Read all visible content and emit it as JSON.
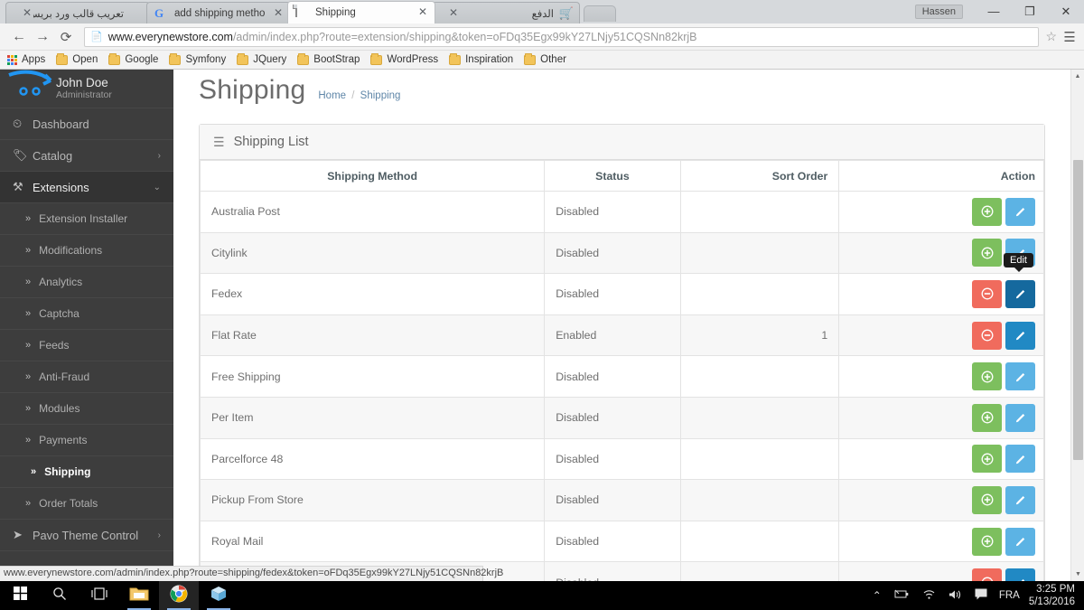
{
  "browser": {
    "profile_chip": "Hassen",
    "window_buttons": {
      "minimize": "—",
      "maximize": "❐",
      "close": "✕"
    },
    "tabs": [
      {
        "title": "تعريب قالب ورد بريس مع |",
        "favicon": "blue-app-icon",
        "active": false,
        "rtl": true
      },
      {
        "title": "add shipping method ope",
        "favicon": "google-icon",
        "active": false,
        "rtl": false
      },
      {
        "title": "Shipping",
        "favicon": "page-icon",
        "active": true,
        "rtl": false
      },
      {
        "title": "الدفع",
        "favicon": "cart-icon",
        "active": false,
        "rtl": true
      }
    ],
    "tab_close_glyph": "✕",
    "nav": {
      "back": "←",
      "forward": "→",
      "reload": "⟳"
    },
    "omnibox": {
      "host": "www.everynewstore.com",
      "path": "/admin/index.php?route=extension/shipping&token=oFDq35Egx99kY27LNjy51CQSNn82krjB",
      "star": "☆",
      "menu": "☰"
    },
    "bookmarks": [
      {
        "label": "Apps",
        "icon": "apps-grid-icon"
      },
      {
        "label": "Open",
        "icon": "folder-icon"
      },
      {
        "label": "Google",
        "icon": "folder-icon"
      },
      {
        "label": "Symfony",
        "icon": "folder-icon"
      },
      {
        "label": "JQuery",
        "icon": "folder-icon"
      },
      {
        "label": "BootStrap",
        "icon": "folder-icon"
      },
      {
        "label": "WordPress",
        "icon": "folder-icon"
      },
      {
        "label": "Inspiration",
        "icon": "folder-icon"
      },
      {
        "label": "Other",
        "icon": "folder-icon"
      }
    ],
    "status_link": "www.everynewstore.com/admin/index.php?route=shipping/fedex&token=oFDq35Egx99kY27LNjy51CQSNn82krjB"
  },
  "sidebar": {
    "user": {
      "name": "John Doe",
      "role": "Administrator"
    },
    "items": [
      {
        "label": "Dashboard",
        "icon": "dashboard-icon",
        "caret": "",
        "state": ""
      },
      {
        "label": "Catalog",
        "icon": "tag-icon",
        "caret": "›",
        "state": ""
      },
      {
        "label": "Extensions",
        "icon": "puzzle-icon",
        "caret": "⌄",
        "state": "open"
      }
    ],
    "sub_items": [
      {
        "label": "Extension Installer",
        "active": false
      },
      {
        "label": "Modifications",
        "active": false
      },
      {
        "label": "Analytics",
        "active": false
      },
      {
        "label": "Captcha",
        "active": false
      },
      {
        "label": "Feeds",
        "active": false
      },
      {
        "label": "Anti-Fraud",
        "active": false
      },
      {
        "label": "Modules",
        "active": false
      },
      {
        "label": "Payments",
        "active": false
      },
      {
        "label": "Shipping",
        "active": true
      },
      {
        "label": "Order Totals",
        "active": false
      }
    ],
    "bottom_items": [
      {
        "label": "Pavo Theme Control",
        "icon": "rocket-icon",
        "caret": "›"
      }
    ],
    "sub_chevron": "»"
  },
  "page": {
    "title": "Shipping",
    "breadcrumb": {
      "home": "Home",
      "separator": "/",
      "current": "Shipping"
    },
    "panel_title": "Shipping List",
    "panel_icon": "list-icon"
  },
  "table": {
    "columns": [
      "Shipping Method",
      "Status",
      "Sort Order",
      "Action"
    ],
    "rows": [
      {
        "method": "Australia Post",
        "status": "Disabled",
        "sort_order": "",
        "install_state": "install",
        "edit_state": "light"
      },
      {
        "method": "Citylink",
        "status": "Disabled",
        "sort_order": "",
        "install_state": "install",
        "edit_state": "light"
      },
      {
        "method": "Fedex",
        "status": "Disabled",
        "sort_order": "",
        "install_state": "uninstall",
        "edit_state": "hover"
      },
      {
        "method": "Flat Rate",
        "status": "Enabled",
        "sort_order": "1",
        "install_state": "uninstall",
        "edit_state": "dark"
      },
      {
        "method": "Free Shipping",
        "status": "Disabled",
        "sort_order": "",
        "install_state": "install",
        "edit_state": "light"
      },
      {
        "method": "Per Item",
        "status": "Disabled",
        "sort_order": "",
        "install_state": "install",
        "edit_state": "light"
      },
      {
        "method": "Parcelforce 48",
        "status": "Disabled",
        "sort_order": "",
        "install_state": "install",
        "edit_state": "light"
      },
      {
        "method": "Pickup From Store",
        "status": "Disabled",
        "sort_order": "",
        "install_state": "install",
        "edit_state": "light"
      },
      {
        "method": "Royal Mail",
        "status": "Disabled",
        "sort_order": "",
        "install_state": "install",
        "edit_state": "light"
      },
      {
        "method": "",
        "status": "Disabled",
        "sort_order": "",
        "install_state": "uninstall",
        "edit_state": "dark"
      }
    ],
    "tooltip": "Edit",
    "button_titles": {
      "install": "Install",
      "uninstall": "Uninstall",
      "edit": "Edit"
    }
  },
  "taskbar": {
    "apps": [
      {
        "name": "start-button",
        "icon": "windows-logo-icon"
      },
      {
        "name": "search-button",
        "icon": "search-icon"
      },
      {
        "name": "task-view-button",
        "icon": "task-view-icon"
      },
      {
        "name": "file-explorer",
        "icon": "folder-icon"
      },
      {
        "name": "chrome",
        "icon": "chrome-icon"
      },
      {
        "name": "app-cube",
        "icon": "cube-icon"
      }
    ],
    "tray": {
      "expand": "⌃",
      "battery": "battery-icon",
      "wifi": "wifi-icon",
      "volume": "volume-icon",
      "action_center": "action-center-icon",
      "language": "FRA",
      "time": "3:25 PM",
      "date": "5/13/2016"
    }
  },
  "colors": {
    "accent_blue": "#2189c4",
    "install_green": "#7dbf5e",
    "uninstall_red": "#f06b5d",
    "edit_blue": "#5cb3e4",
    "sidebar_bg": "#3d3d3d"
  }
}
